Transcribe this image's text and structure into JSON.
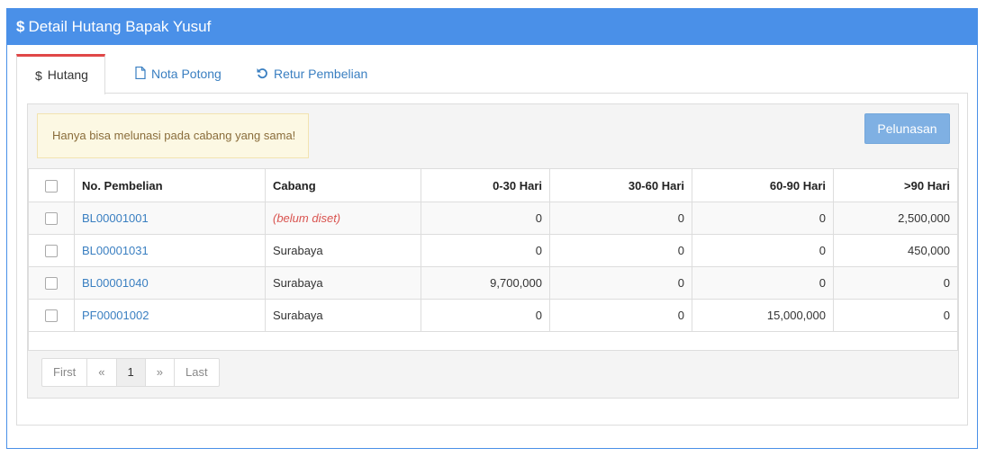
{
  "header": {
    "icon": "dollar-icon",
    "title": "Detail Hutang Bapak Yusuf",
    "color": "#4a90e8"
  },
  "tabs": [
    {
      "label": "Hutang",
      "icon": "dollar-icon",
      "active": true
    },
    {
      "label": "Nota Potong",
      "icon": "document-icon",
      "active": false
    },
    {
      "label": "Retur Pembelian",
      "icon": "undo-icon",
      "active": false
    }
  ],
  "alert": {
    "text": "Hanya bisa melunasi pada cabang yang sama!"
  },
  "actions": {
    "pelunasan_label": "Pelunasan"
  },
  "table": {
    "headers": [
      "No. Pembelian",
      "Cabang",
      "0-30 Hari",
      "30-60 Hari",
      "60-90 Hari",
      ">90 Hari"
    ],
    "rows": [
      {
        "no": "BL00001001",
        "cabang": "(belum diset)",
        "d0_30": "0",
        "d30_60": "0",
        "d60_90": "0",
        "d90": "2,500,000"
      },
      {
        "no": "BL00001031",
        "cabang": "Surabaya",
        "d0_30": "0",
        "d30_60": "0",
        "d60_90": "0",
        "d90": "450,000"
      },
      {
        "no": "BL00001040",
        "cabang": "Surabaya",
        "d0_30": "9,700,000",
        "d30_60": "0",
        "d60_90": "0",
        "d90": "0"
      },
      {
        "no": "PF00001002",
        "cabang": "Surabaya",
        "d0_30": "0",
        "d30_60": "0",
        "d60_90": "15,000,000",
        "d90": "0"
      }
    ]
  },
  "pagination": {
    "first": "First",
    "prev": "«",
    "current": "1",
    "next": "»",
    "last": "Last"
  }
}
